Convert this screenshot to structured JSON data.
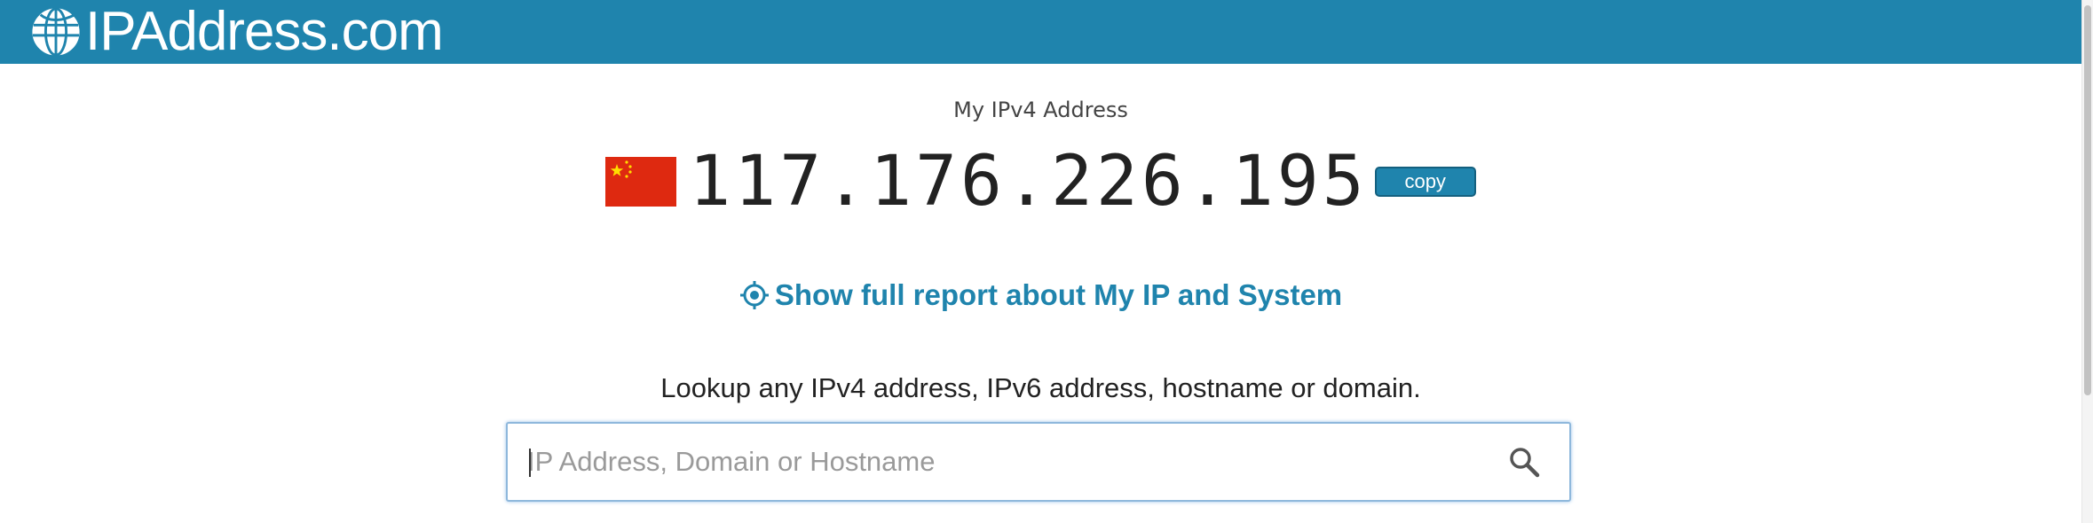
{
  "header": {
    "logo_text": "IPAddress.com",
    "colors": {
      "brand": "#1f84ad"
    }
  },
  "ip_section": {
    "heading": "My IPv4 Address",
    "flag_icon": "china-flag-icon",
    "ip_address": "117.176.226.195",
    "copy_label": "copy"
  },
  "report_link": {
    "icon": "target-icon",
    "label": "Show full report about My IP and System"
  },
  "lookup": {
    "prompt": "Lookup any IPv4 address, IPv6 address, hostname or domain.",
    "placeholder": "IP Address, Domain or Hostname",
    "value": "",
    "search_icon": "search-icon"
  }
}
